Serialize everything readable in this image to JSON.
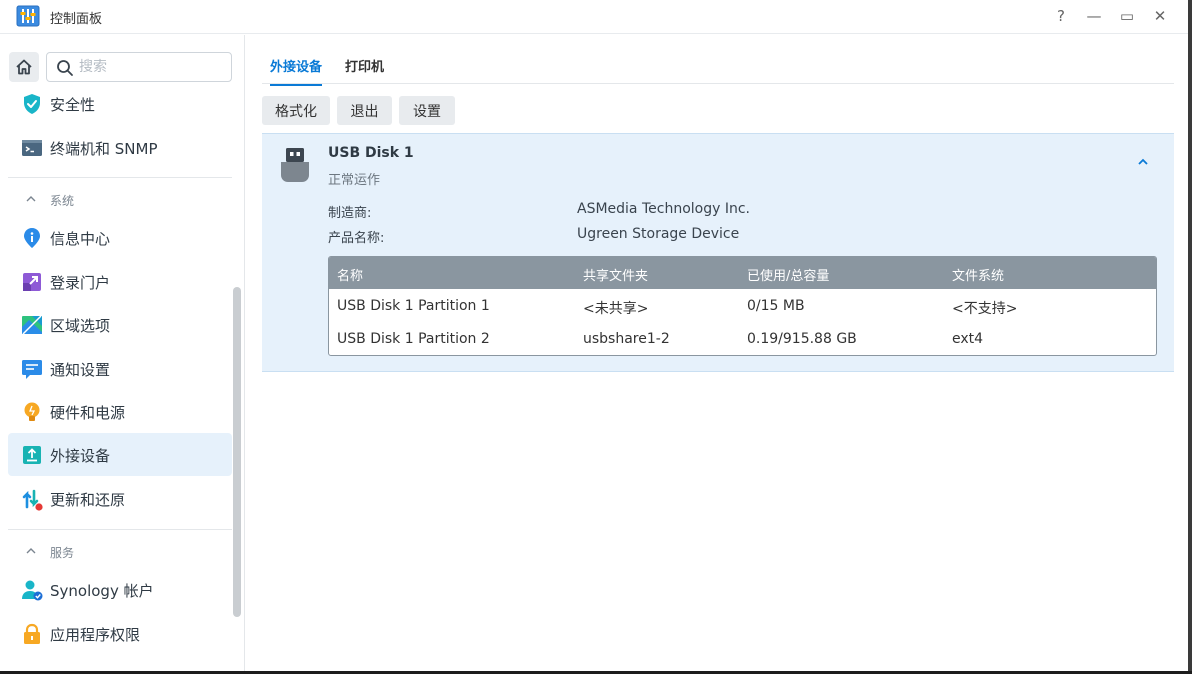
{
  "window": {
    "title": "控制面板"
  },
  "controls": {
    "help": "?",
    "minimize": "—",
    "maximize": "▭",
    "close": "✕"
  },
  "search": {
    "placeholder": "搜索"
  },
  "sidebar": {
    "items": [
      {
        "label": "安全性"
      },
      {
        "label": "终端机和 SNMP"
      },
      {
        "label": "信息中心"
      },
      {
        "label": "登录门户"
      },
      {
        "label": "区域选项"
      },
      {
        "label": "通知设置"
      },
      {
        "label": "硬件和电源"
      },
      {
        "label": "外接设备"
      },
      {
        "label": "更新和还原"
      },
      {
        "label": "Synology 帐户"
      },
      {
        "label": "应用程序权限"
      }
    ],
    "sections": {
      "system": "系统",
      "services": "服务"
    }
  },
  "tabs": [
    {
      "label": "外接设备"
    },
    {
      "label": "打印机"
    }
  ],
  "toolbar": {
    "format": "格式化",
    "eject": "退出",
    "settings": "设置"
  },
  "device": {
    "name": "USB Disk 1",
    "status": "正常运作",
    "manufacturer_label": "制造商:",
    "manufacturer": "ASMedia Technology Inc.",
    "product_label": "产品名称:",
    "product": "Ugreen Storage Device"
  },
  "partitions": {
    "headers": [
      "名称",
      "共享文件夹",
      "已使用/总容量",
      "文件系统"
    ],
    "rows": [
      [
        "USB Disk 1 Partition 1",
        "<未共享>",
        "0/15 MB",
        "<不支持>"
      ],
      [
        "USB Disk 1 Partition 2",
        "usbshare1-2",
        "0.19/915.88 GB",
        "ext4"
      ]
    ]
  },
  "colors": {
    "accent": "#0a7ad6",
    "panel_bg": "#e6f1fb",
    "table_header": "#8a96a0"
  }
}
